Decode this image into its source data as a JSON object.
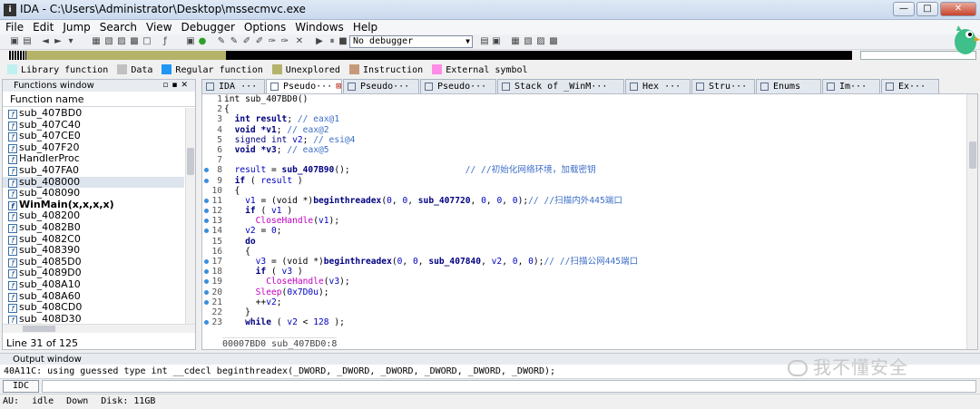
{
  "window": {
    "title": "IDA - C:\\Users\\Administrator\\Desktop\\mssecmvc.exe",
    "minimize": "—",
    "maximize": "□",
    "close": "✕"
  },
  "menu": [
    "File",
    "Edit",
    "Jump",
    "Search",
    "View",
    "Debugger",
    "Options",
    "Windows",
    "Help"
  ],
  "toolbar": {
    "debugger_value": "No debugger"
  },
  "legend": [
    {
      "label": "Library function",
      "color": "#bff0f0"
    },
    {
      "label": "Data",
      "color": "#c0c0c0"
    },
    {
      "label": "Regular function",
      "color": "#2196f3"
    },
    {
      "label": "Unexplored",
      "color": "#b5b36a"
    },
    {
      "label": "Instruction",
      "color": "#c59a7a"
    },
    {
      "label": "External symbol",
      "color": "#ff8ce6"
    }
  ],
  "functions_panel": {
    "title": "Functions window",
    "column": "Function name",
    "items": [
      {
        "name": "sub_407BD0",
        "bold": false,
        "selected": false
      },
      {
        "name": "sub_407C40",
        "bold": false,
        "selected": false
      },
      {
        "name": "sub_407CE0",
        "bold": false,
        "selected": false
      },
      {
        "name": "sub_407F20",
        "bold": false,
        "selected": false
      },
      {
        "name": "HandlerProc",
        "bold": false,
        "selected": false
      },
      {
        "name": "sub_407FA0",
        "bold": false,
        "selected": false
      },
      {
        "name": "sub_408000",
        "bold": false,
        "selected": true
      },
      {
        "name": "sub_408090",
        "bold": false,
        "selected": false
      },
      {
        "name": "WinMain(x,x,x,x)",
        "bold": true,
        "selected": false
      },
      {
        "name": "sub_408200",
        "bold": false,
        "selected": false
      },
      {
        "name": "sub_4082B0",
        "bold": false,
        "selected": false
      },
      {
        "name": "sub_4082C0",
        "bold": false,
        "selected": false
      },
      {
        "name": "sub_408390",
        "bold": false,
        "selected": false
      },
      {
        "name": "sub_4085D0",
        "bold": false,
        "selected": false
      },
      {
        "name": "sub_4089D0",
        "bold": false,
        "selected": false
      },
      {
        "name": "sub_408A10",
        "bold": false,
        "selected": false
      },
      {
        "name": "sub_408A60",
        "bold": false,
        "selected": false
      },
      {
        "name": "sub_408CD0",
        "bold": false,
        "selected": false
      },
      {
        "name": "sub_408D30",
        "bold": false,
        "selected": false
      }
    ],
    "status": "Line 31 of 125"
  },
  "tabs": [
    {
      "label": "IDA ···",
      "active": false,
      "closable": false
    },
    {
      "label": "Pseudo···",
      "active": true,
      "closable": true
    },
    {
      "label": "Pseudo···",
      "active": false,
      "closable": false
    },
    {
      "label": "Pseudo···",
      "active": false,
      "closable": false
    },
    {
      "label": "Stack of _WinM···",
      "active": false,
      "closable": false
    },
    {
      "label": "Hex ···",
      "active": false,
      "closable": false
    },
    {
      "label": "Stru···",
      "active": false,
      "closable": false
    },
    {
      "label": "Enums",
      "active": false,
      "closable": false
    },
    {
      "label": "Im···",
      "active": false,
      "closable": false
    },
    {
      "label": "Ex···",
      "active": false,
      "closable": false
    }
  ],
  "code": {
    "lines": [
      {
        "n": "1",
        "dot": false,
        "html": "int sub_407BD0()"
      },
      {
        "n": "2",
        "dot": false,
        "html": "{"
      },
      {
        "n": "3",
        "dot": false,
        "html": "  <span class=\"kw\">int</span> <span class=\"kw\">result</span>; <span class=\"cm\">// eax@1</span>"
      },
      {
        "n": "4",
        "dot": false,
        "html": "  <span class=\"kw\">void</span> <span class=\"kw\">*v1</span>; <span class=\"cm\">// eax@2</span>"
      },
      {
        "n": "5",
        "dot": false,
        "html": "  <span class=\"ty\">signed int</span> <span class=\"vr\">v2</span>; <span class=\"cm\">// esi@4</span>"
      },
      {
        "n": "6",
        "dot": false,
        "html": "  <span class=\"kw\">void</span> <span class=\"kw\">*v3</span>; <span class=\"cm\">// eax@5</span>"
      },
      {
        "n": "7",
        "dot": false,
        "html": ""
      },
      {
        "n": "8",
        "dot": true,
        "html": "  <span class=\"vr\">result</span> = <span class=\"fn\">sub_407B90</span>();                      <span class=\"cm\">// //初始化网络环境，加载密钥</span>"
      },
      {
        "n": "9",
        "dot": true,
        "html": "  <span class=\"kw\">if</span> ( <span class=\"vr\">result</span> )"
      },
      {
        "n": "10",
        "dot": false,
        "html": "  {"
      },
      {
        "n": "11",
        "dot": true,
        "html": "    <span class=\"vr\">v1</span> = (void *)<span class=\"fn\">beginthreadex</span>(<span class=\"ct\">0</span>, <span class=\"ct\">0</span>, <span class=\"fn\">sub_407720</span>, <span class=\"ct\">0</span>, <span class=\"ct\">0</span>, <span class=\"ct\">0</span>);<span class=\"cm\">// //扫描内外445端口</span>"
      },
      {
        "n": "12",
        "dot": true,
        "html": "    <span class=\"kw\">if</span> ( <span class=\"vr\">v1</span> )"
      },
      {
        "n": "13",
        "dot": true,
        "html": "      <span class=\"fnp\">CloseHandle</span>(<span class=\"vr\">v1</span>);"
      },
      {
        "n": "14",
        "dot": true,
        "html": "    <span class=\"vr\">v2</span> = <span class=\"ct\">0</span>;"
      },
      {
        "n": "15",
        "dot": false,
        "html": "    <span class=\"kw\">do</span>"
      },
      {
        "n": "16",
        "dot": false,
        "html": "    {"
      },
      {
        "n": "17",
        "dot": true,
        "html": "      <span class=\"vr\">v3</span> = (void *)<span class=\"fn\">beginthreadex</span>(<span class=\"ct\">0</span>, <span class=\"ct\">0</span>, <span class=\"fn\">sub_407840</span>, <span class=\"vr\">v2</span>, <span class=\"ct\">0</span>, <span class=\"ct\">0</span>);<span class=\"cm\">// //扫描公网445端口</span>"
      },
      {
        "n": "18",
        "dot": true,
        "html": "      <span class=\"kw\">if</span> ( <span class=\"vr\">v3</span> )"
      },
      {
        "n": "19",
        "dot": true,
        "html": "        <span class=\"fnp\">CloseHandle</span>(<span class=\"vr\">v3</span>);"
      },
      {
        "n": "20",
        "dot": true,
        "html": "      <span class=\"fnp\">Sleep</span>(<span class=\"ct\">0x7D0u</span>);"
      },
      {
        "n": "21",
        "dot": true,
        "html": "      ++<span class=\"vr\">v2</span>;"
      },
      {
        "n": "22",
        "dot": false,
        "html": "    }"
      },
      {
        "n": "23",
        "dot": true,
        "html": "    <span class=\"kw\">while</span> ( <span class=\"vr\">v2</span> &lt; <span class=\"ct\">128</span> );"
      }
    ],
    "status": "00007BD0 sub_407BD0:8"
  },
  "output": {
    "title": "Output window",
    "text": "40A11C: using guessed type int __cdecl beginthreadex(_DWORD, _DWORD, _DWORD, _DWORD, _DWORD, _DWORD);",
    "idc_label": "IDC"
  },
  "statusbar": {
    "au": "AU:",
    "state": "idle",
    "dir": "Down",
    "disk": "Disk: 11GB"
  },
  "watermark": "我不懂安全"
}
